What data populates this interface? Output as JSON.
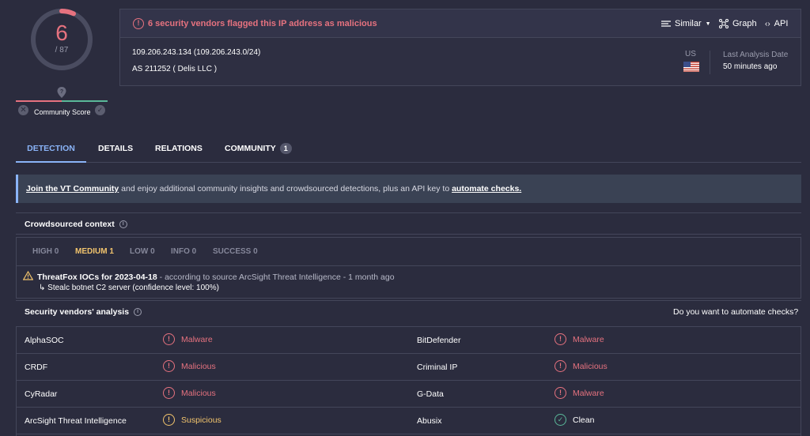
{
  "score": {
    "detections": "6",
    "total": "/ 87",
    "community_label": "Community Score"
  },
  "header": {
    "alert": "6 security vendors flagged this IP address as malicious",
    "tools": {
      "similar": "Similar",
      "graph": "Graph",
      "api": "API"
    },
    "ip": "109.206.243.134  (109.206.243.0/24)",
    "as": "AS 211252  ( Delis LLC )",
    "country": "US",
    "last_analysis_label": "Last Analysis Date",
    "last_analysis_value": "50 minutes ago"
  },
  "tabs": [
    {
      "label": "DETECTION"
    },
    {
      "label": "DETAILS"
    },
    {
      "label": "RELATIONS"
    },
    {
      "label": "COMMUNITY",
      "badge": "1"
    }
  ],
  "banner": {
    "link1": "Join the VT Community",
    "middle": " and enjoy additional community insights and crowdsourced detections, plus an API key to ",
    "link2": "automate checks."
  },
  "crowdsourced": {
    "title": "Crowdsourced context",
    "filters": [
      "HIGH 0",
      "MEDIUM 1",
      "LOW 0",
      "INFO 0",
      "SUCCESS 0"
    ],
    "ioc_title": "ThreatFox IOCs for 2023-04-18",
    "ioc_source": " - according to source ArcSight Threat Intelligence - 1 month ago",
    "ioc_sub": "↳ Stealc botnet C2 server (confidence level: 100%)"
  },
  "vendors": {
    "title": "Security vendors' analysis",
    "automate": "Do you want to automate checks?",
    "rows": [
      {
        "left": {
          "name": "AlphaSOC",
          "result": "Malware"
        },
        "right": {
          "name": "BitDefender",
          "result": "Malware"
        }
      },
      {
        "left": {
          "name": "CRDF",
          "result": "Malicious"
        },
        "right": {
          "name": "Criminal IP",
          "result": "Malicious"
        }
      },
      {
        "left": {
          "name": "CyRadar",
          "result": "Malicious"
        },
        "right": {
          "name": "G-Data",
          "result": "Malware"
        }
      },
      {
        "left": {
          "name": "ArcSight Threat Intelligence",
          "result": "Suspicious"
        },
        "right": {
          "name": "Abusix",
          "result": "Clean"
        }
      }
    ]
  },
  "colors": {
    "malicious": "#e6727f",
    "suspicious": "#f2c46d",
    "clean": "#5ab899",
    "accent": "#8ab4f8"
  }
}
